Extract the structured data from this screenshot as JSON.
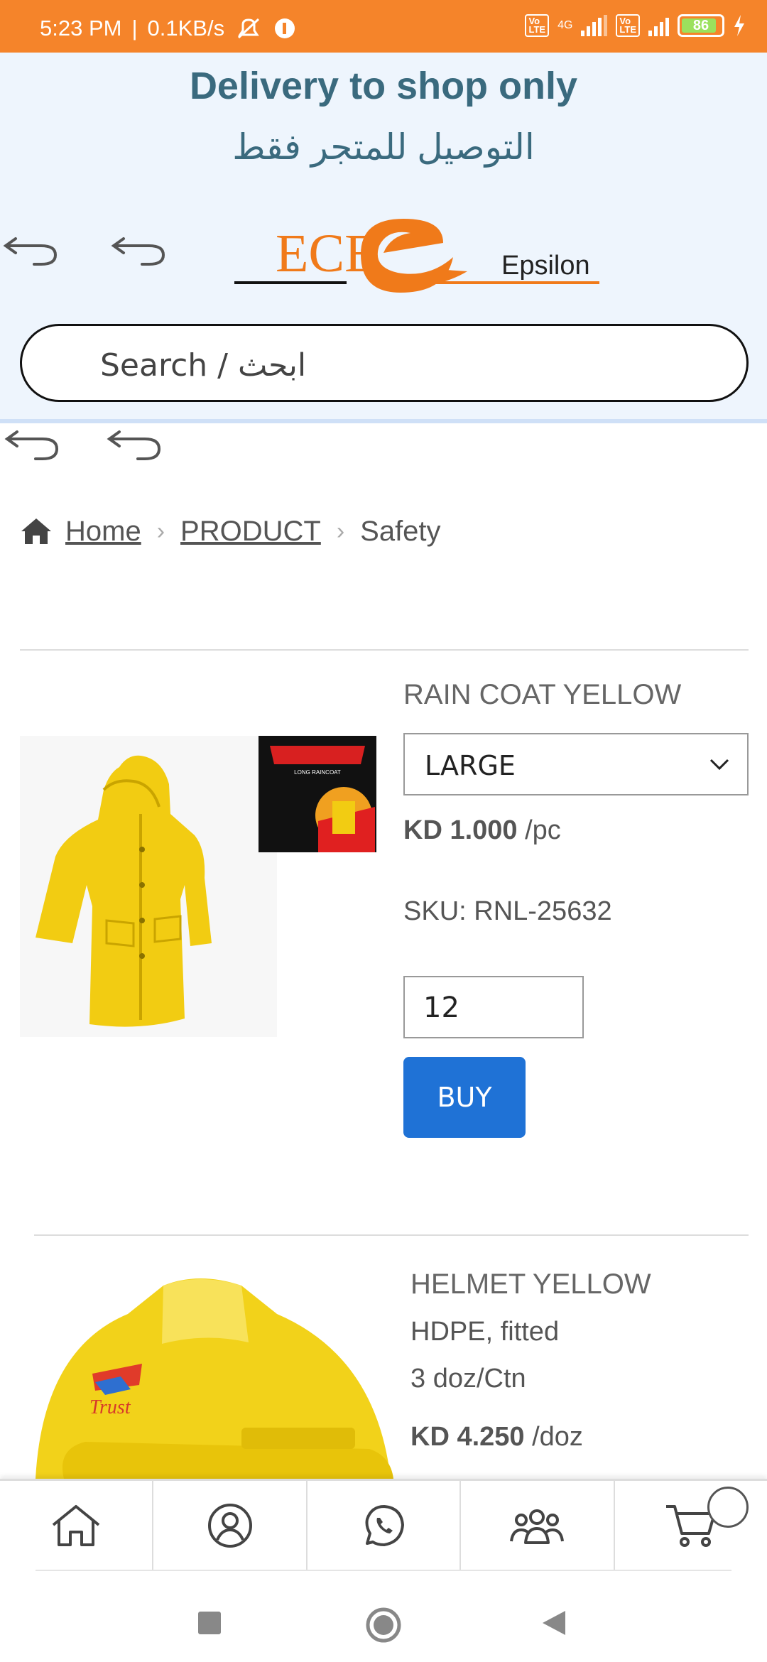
{
  "status_bar": {
    "time": "5:23 PM",
    "speed": "0.1KB/s",
    "network": "4G",
    "lte_badge": "Vo LTE",
    "battery": "86"
  },
  "header": {
    "delivery_en": "Delivery to shop only",
    "delivery_ar": "التوصيل للمتجر فقط",
    "logo_text": "Epsilon",
    "logo_letters": "ECE"
  },
  "search": {
    "placeholder": "Search / ابحث"
  },
  "breadcrumb": {
    "home": "Home",
    "product": "PRODUCT",
    "current": "Safety"
  },
  "products": [
    {
      "title": "RAIN COAT YELLOW",
      "size_selected": "LARGE",
      "price": "KD 1.000",
      "unit": "/pc",
      "sku": "SKU: RNL-25632",
      "quantity": "12",
      "buy_label": "BUY",
      "package_label": "LONG RAINCOAT"
    },
    {
      "title": "HELMET YELLOW",
      "desc_line1": "HDPE, fitted",
      "desc_line2": "3 doz/Ctn",
      "price": "KD 4.250",
      "unit": "/doz",
      "brand": "Trust"
    }
  ],
  "colors": {
    "status_bar": "#f5842a",
    "header_bg": "#eef5fd",
    "header_text": "#3a6a7e",
    "buy_button": "#1f72d6",
    "logo_orange": "#f07a1a"
  },
  "icons": {
    "nav": [
      "home-icon",
      "user-icon",
      "whatsapp-icon",
      "group-icon",
      "cart-icon"
    ],
    "system": [
      "square-icon",
      "circle-icon",
      "triangle-icon"
    ]
  }
}
